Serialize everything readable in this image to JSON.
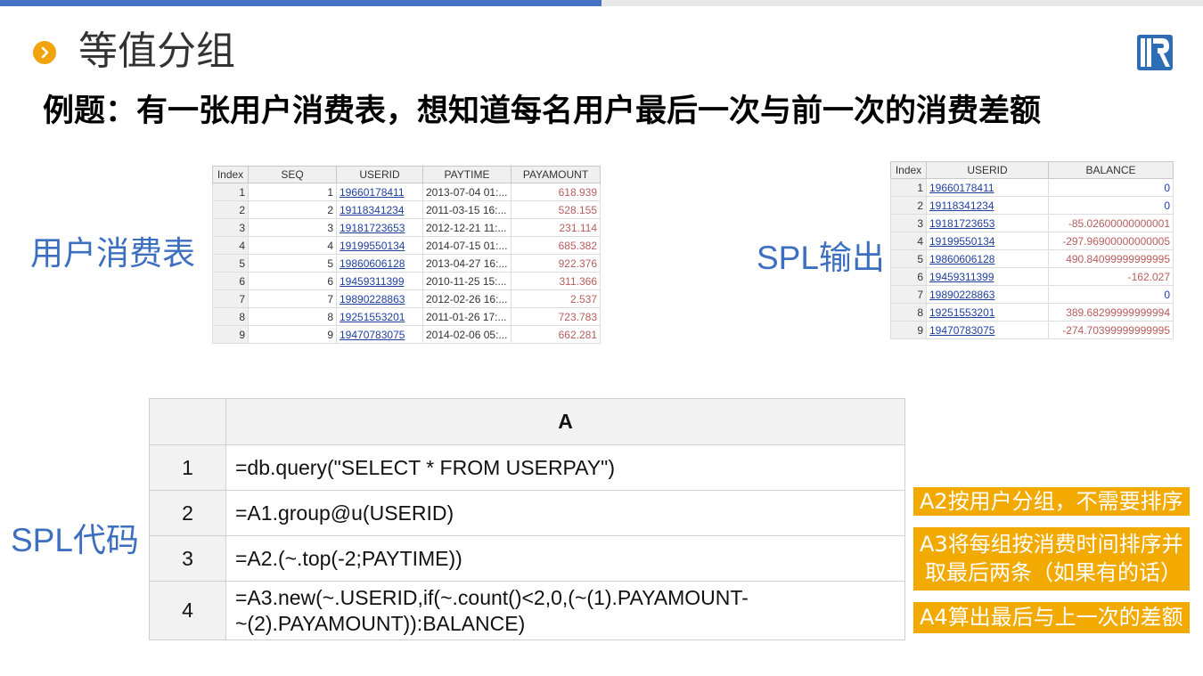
{
  "page": {
    "title": "等值分组",
    "subtitle": "例题：有一张用户消费表，想知道每名用户最后一次与前一次的消费差额",
    "label_table": "用户消费表",
    "label_output": "SPL输出",
    "label_code": "SPL代码",
    "bullet_icon": "chevron-right-icon",
    "logo_icon": "raqsoft-r-logo-icon",
    "accent": "#f0a30a",
    "blue": "#3d6fc0"
  },
  "pay_table": {
    "headers": [
      "Index",
      "SEQ",
      "USERID",
      "PAYTIME",
      "PAYAMOUNT"
    ],
    "rows": [
      [
        "1",
        "1",
        "19660178411",
        "2013-07-04 01:...",
        "618.939"
      ],
      [
        "2",
        "2",
        "19118341234",
        "2011-03-15 16:...",
        "528.155"
      ],
      [
        "3",
        "3",
        "19181723653",
        "2012-12-21 11:...",
        "231.114"
      ],
      [
        "4",
        "4",
        "19199550134",
        "2014-07-15 01:...",
        "685.382"
      ],
      [
        "5",
        "5",
        "19860606128",
        "2013-04-27 16:...",
        "922.376"
      ],
      [
        "6",
        "6",
        "19459311399",
        "2010-11-25 15:...",
        "311.366"
      ],
      [
        "7",
        "7",
        "19890228863",
        "2012-02-26 16:...",
        "2.537"
      ],
      [
        "8",
        "8",
        "19251553201",
        "2011-01-26 17:...",
        "723.783"
      ],
      [
        "9",
        "9",
        "19470783075",
        "2014-02-06 05:...",
        "662.281"
      ]
    ]
  },
  "out_table": {
    "headers": [
      "Index",
      "USERID",
      "BALANCE"
    ],
    "rows": [
      [
        "1",
        "19660178411",
        "0"
      ],
      [
        "2",
        "19118341234",
        "0"
      ],
      [
        "3",
        "19181723653",
        "-85.02600000000001"
      ],
      [
        "4",
        "19199550134",
        "-297.96900000000005"
      ],
      [
        "5",
        "19860606128",
        "490.84099999999995"
      ],
      [
        "6",
        "19459311399",
        "-162.027"
      ],
      [
        "7",
        "19890228863",
        "0"
      ],
      [
        "8",
        "19251553201",
        "389.68299999999994"
      ],
      [
        "9",
        "19470783075",
        "-274.70399999999995"
      ]
    ]
  },
  "code": {
    "column_header": "A",
    "rows": [
      {
        "num": "1",
        "line1": "=db.query(\"SELECT * FROM USERPAY\")",
        "line2": ""
      },
      {
        "num": "2",
        "line1": "=A1.group@u(USERID)",
        "line2": ""
      },
      {
        "num": "3",
        "line1": "=A2.(~.top(-2;PAYTIME))",
        "line2": ""
      },
      {
        "num": "4",
        "line1": "=A3.new(~.USERID,if(~.count()<2,0,(~(1).PAYAMOUNT-",
        "line2": "~(2).PAYAMOUNT)):BALANCE)"
      }
    ]
  },
  "notes": {
    "a2": "A2按用户分组，不需要排序",
    "a3_line1": "A3将每组按消费时间排序并",
    "a3_line2": "取最后两条（如果有的话）",
    "a4": "A4算出最后与上一次的差额"
  }
}
